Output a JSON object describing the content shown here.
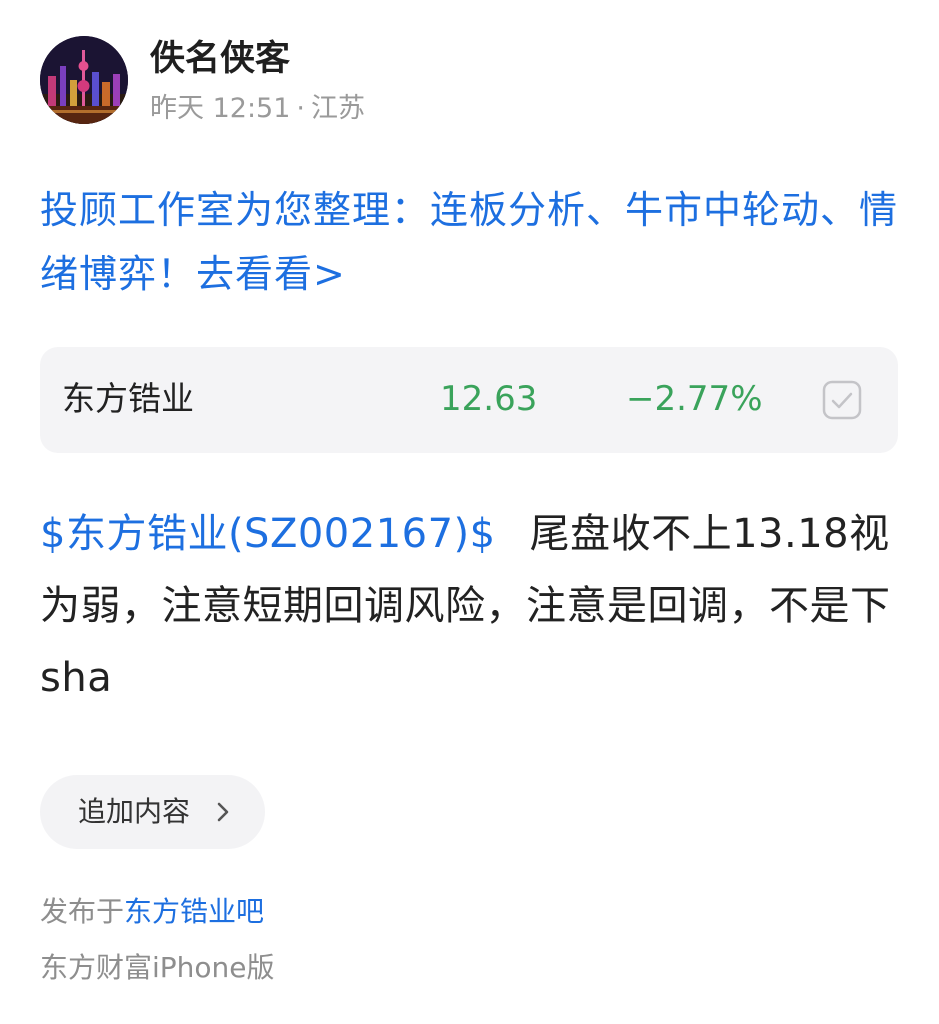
{
  "author": {
    "name": "佚名侠客",
    "time": "昨天 12:51",
    "separator": "·",
    "location": "江苏"
  },
  "promo": {
    "text": "投顾工作室为您整理：连板分析、牛市中轮动、情绪博弈！去看看>"
  },
  "stock_card": {
    "name": "东方锆业",
    "price": "12.63",
    "change": "−2.77%",
    "color_down": "#3aa35b",
    "check_icon": "checkbox-icon"
  },
  "post": {
    "stock_link": "$东方锆业(SZ002167)$",
    "body": "尾盘收不上13.18视为弱，注意短期回调风险，注意是回调，不是下sha"
  },
  "add_content": {
    "label": "追加内容",
    "icon": "chevron-right-icon"
  },
  "footer": {
    "published_prefix": "发布于",
    "bar_name": "东方锆业吧",
    "client": "东方财富iPhone版"
  },
  "colors": {
    "link": "#1d6fe0",
    "muted": "#9a9a9a",
    "card_bg": "#f4f4f6"
  }
}
